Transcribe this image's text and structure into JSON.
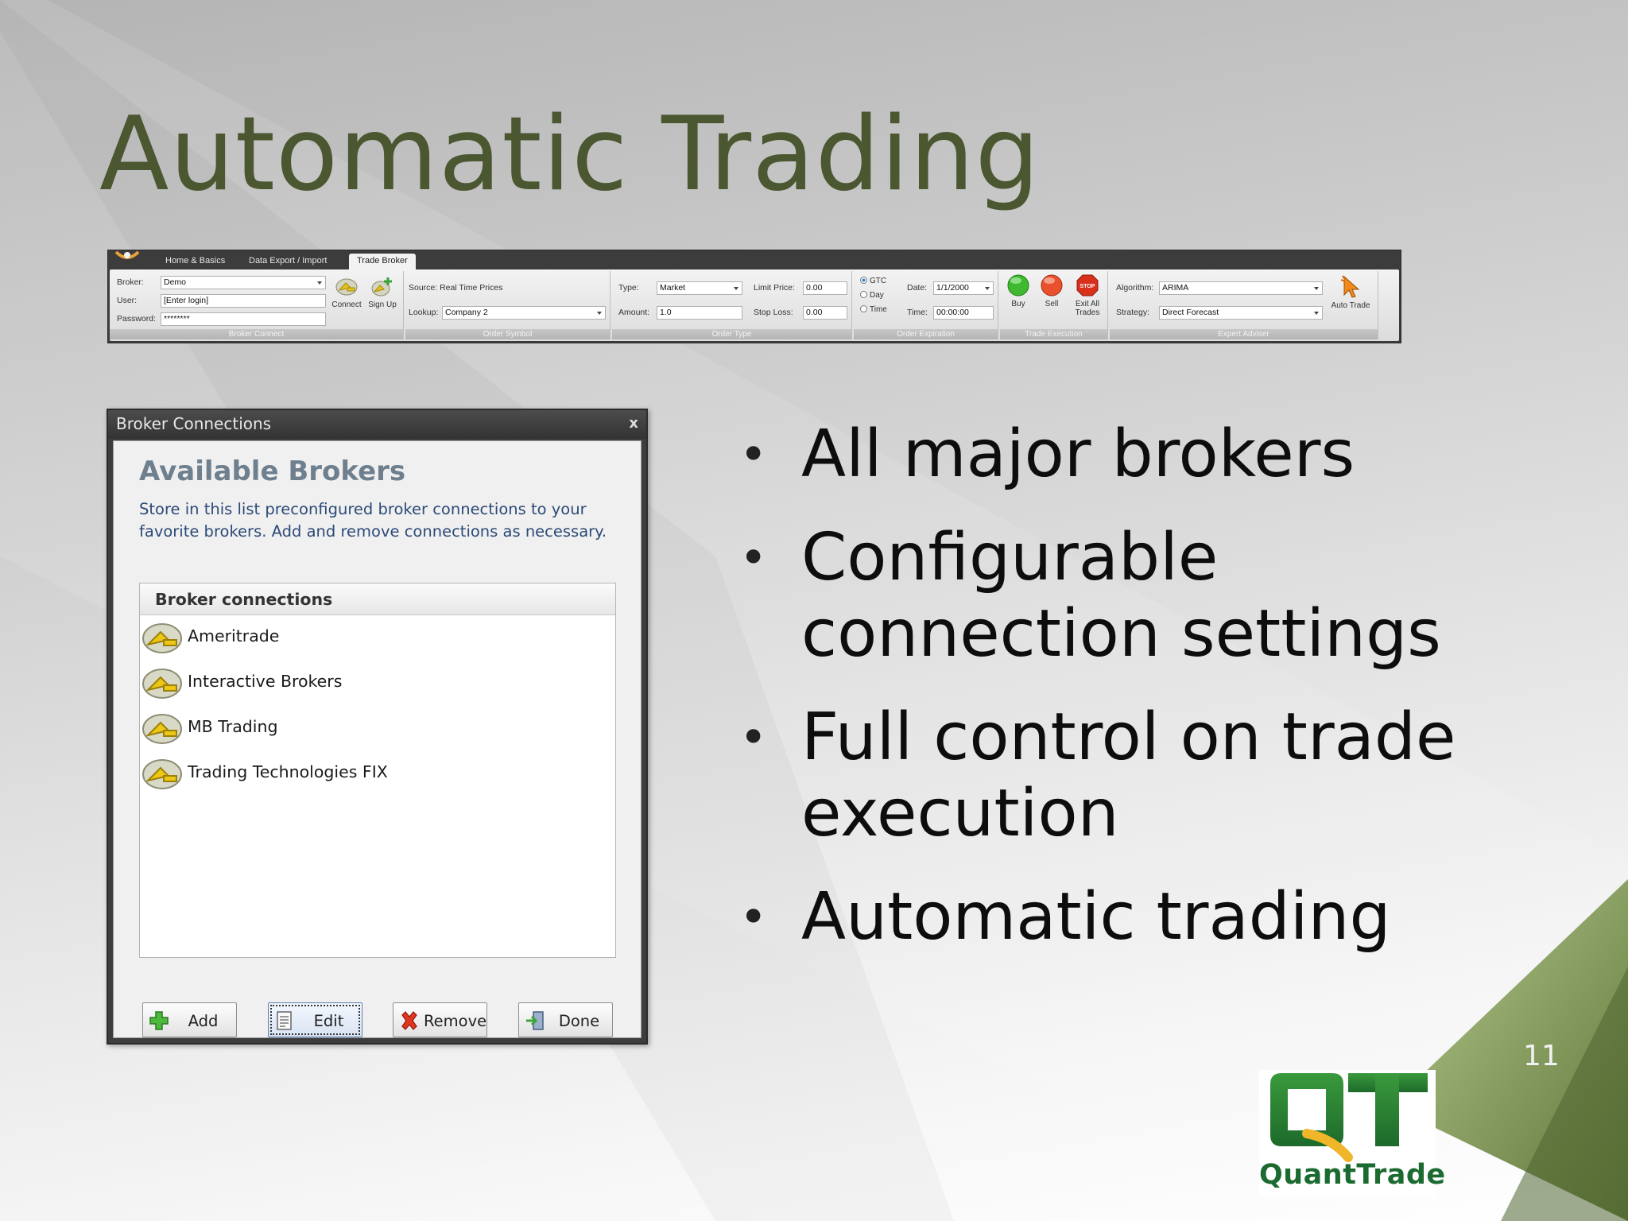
{
  "slide": {
    "title": "Automatic Trading",
    "page_number": "11",
    "bullets": [
      "All major brokers",
      "Configurable connection settings",
      "Full control on trade execution",
      "Automatic trading"
    ],
    "logo_text": "QuantTrade"
  },
  "ribbon": {
    "tabs": [
      "Home & Basics",
      "Data Export / Import",
      "Trade Broker"
    ],
    "active_tab": "Trade Broker",
    "broker_connect": {
      "broker_label": "Broker:",
      "broker_value": "Demo",
      "user_label": "User:",
      "user_value": "[Enter login]",
      "password_label": "Password:",
      "password_value": "********",
      "connect_label": "Connect",
      "signup_label": "Sign Up",
      "caption": "Broker Connect"
    },
    "order_symbol": {
      "source_text": "Source: Real Time Prices",
      "lookup_label": "Lookup:",
      "lookup_value": "Company 2",
      "caption": "Order Symbol"
    },
    "order_type": {
      "type_label": "Type:",
      "type_value": "Market",
      "amount_label": "Amount:",
      "amount_value": "1.0",
      "limit_label": "Limit Price:",
      "limit_value": "0.00",
      "stop_label": "Stop Loss:",
      "stop_value": "0.00",
      "caption": "Order Type"
    },
    "order_expiration": {
      "options": [
        "GTC",
        "Day",
        "Time"
      ],
      "date_label": "Date:",
      "date_value": "1/1/2000",
      "time_label": "Time:",
      "time_value": "00:00:00",
      "caption": "Order Expiration"
    },
    "trade_execution": {
      "buy_label": "Buy",
      "sell_label": "Sell",
      "exit_label_1": "Exit All",
      "exit_label_2": "Trades",
      "stop_sign_text": "STOP",
      "caption": "Trade Execution"
    },
    "expert_adviser": {
      "algorithm_label": "Algorithm:",
      "algorithm_value": "ARIMA",
      "strategy_label": "Strategy:",
      "strategy_value": "Direct Forecast",
      "auto_trade_label": "Auto Trade",
      "caption": "Expert Adviser"
    }
  },
  "dialog": {
    "title": "Broker Connections",
    "close": "x",
    "heading": "Available Brokers",
    "description": "Store in this list preconfigured broker connections to your favorite brokers. Add and remove connections as necessary.",
    "list_header": "Broker connections",
    "brokers": [
      "Ameritrade",
      "Interactive Brokers",
      "MB Trading",
      "Trading Technologies FIX"
    ],
    "buttons": {
      "add": "Add",
      "edit": "Edit",
      "remove": "Remove",
      "done": "Done"
    }
  },
  "colors": {
    "title": "#4b5730",
    "accent_green": "#6f8a4a",
    "dialog_heading": "#6e7f8e",
    "dialog_desc": "#2c4a78"
  }
}
